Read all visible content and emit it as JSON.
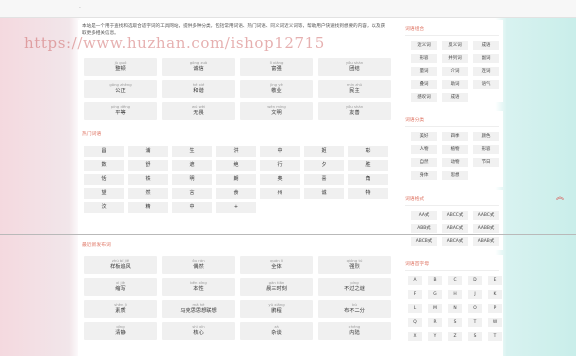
{
  "topbar": {
    "dot": "·"
  },
  "watermark": "https://www.huzhan.com/ishop12715",
  "intro": "本站是一个用于查找和选取合适字词的工具网站，提供多种分类，包括常用词语、热门词语、同义词近义词等，帮助用户快速找到想要的内容，以及获取更多相关信息。",
  "words1": [
    {
      "py": "jù guó",
      "w": "整顿"
    },
    {
      "py": "gōng zuò",
      "w": "诚信"
    },
    {
      "py": "lǐ xiǎng",
      "w": "富强"
    },
    {
      "py": "yǒu shàn",
      "w": "团结"
    },
    {
      "py": "gōng zhèng",
      "w": "公正"
    },
    {
      "py": "hé xié",
      "w": "和谐"
    },
    {
      "py": "jìng yè",
      "w": "敬业"
    },
    {
      "py": "mín zhǔ",
      "w": "民主"
    },
    {
      "py": "píng děng",
      "w": "平等"
    },
    {
      "py": "wú wèi",
      "w": "无畏"
    },
    {
      "py": "wén míng",
      "w": "文明"
    },
    {
      "py": "yǒu shàn",
      "w": "友善"
    }
  ],
  "hot_label": "热门词语",
  "chars": [
    "昌",
    "浦",
    "生",
    "洪",
    "中",
    "姬",
    "彰",
    "数",
    "舒",
    "遮",
    "绝",
    "行",
    "夕",
    "胜",
    "恬",
    "铁",
    "明",
    "朗",
    "奥",
    "喜",
    "角",
    "望",
    "然",
    "言",
    "食",
    "州",
    "诚",
    "特",
    "汶",
    "精",
    "中",
    "+"
  ],
  "recent_label": "最近新发布词",
  "words2": [
    {
      "py": "zhú bǐ jiě",
      "w": "样板追风"
    },
    {
      "py": "ǒu rán",
      "w": "偶然"
    },
    {
      "py": "quán lì",
      "w": "全体"
    },
    {
      "py": "qióng tú",
      "w": "强烈"
    },
    {
      "py": "xì jiè",
      "w": "缩写"
    },
    {
      "py": "běn xīng",
      "w": "本性"
    },
    {
      "py": "gǎn tiān",
      "w": "晨三时刻"
    },
    {
      "py": "píng",
      "w": "不过之谜"
    },
    {
      "py": "shèn jì",
      "w": "素质"
    },
    {
      "py": "mǎ hè",
      "w": "马克思思想联想"
    },
    {
      "py": "yǔ xiāng",
      "w": "鹏程"
    },
    {
      "py": "bù",
      "w": "布不二分"
    },
    {
      "py": "qīng",
      "w": "清静"
    },
    {
      "py": "shì xīn",
      "w": "核心"
    },
    {
      "py": "zá",
      "w": "杂谈"
    },
    {
      "py": "chéng",
      "w": "内陆"
    }
  ],
  "side": {
    "box1_title": "词语组合",
    "box1_items": [
      "近义词",
      "反义词",
      "成语",
      "形容",
      "并列词",
      "副词",
      "量词",
      "介词",
      "连词",
      "叠词",
      "助词",
      "语气",
      "感叹词",
      "成语"
    ],
    "box2_title": "词语分类",
    "box2_items": [
      "美好",
      "四季",
      "颜色",
      "人物",
      "植物",
      "形容",
      "自然",
      "动物",
      "节日",
      "身体",
      "思想"
    ],
    "box3_title": "词语格式",
    "box3_items": [
      "AA式",
      "ABCC式",
      "AABC式",
      "ABB式",
      "ABAC式",
      "AABB式",
      "ABCB式",
      "ABCA式",
      "ABAB式"
    ],
    "box4_title": "词语首字母",
    "box4_items": [
      "A",
      "B",
      "C",
      "D",
      "E",
      "F",
      "G",
      "H",
      "J",
      "K",
      "L",
      "M",
      "N",
      "O",
      "P",
      "Q",
      "R",
      "S",
      "T",
      "W",
      "X",
      "Y",
      "Z",
      "S",
      "T"
    ]
  },
  "totop": "︽"
}
